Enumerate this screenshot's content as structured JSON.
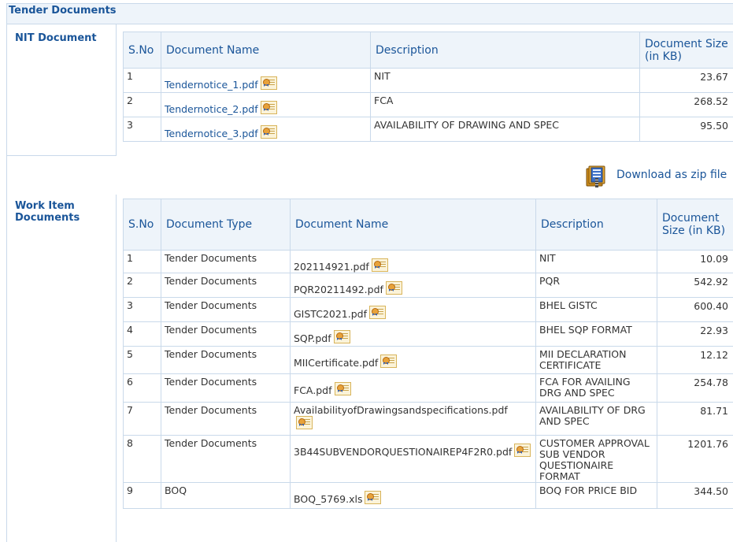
{
  "section": {
    "title": "Tender Documents"
  },
  "nit": {
    "label": "NIT Document",
    "headers": {
      "sno": "S.No",
      "name": "Document Name",
      "description": "Description",
      "size": "Document Size (in KB)"
    },
    "rows": [
      {
        "sno": "1",
        "name": "Tendernotice_1.pdf",
        "description": "NIT",
        "size": "23.67"
      },
      {
        "sno": "2",
        "name": "Tendernotice_2.pdf",
        "description": "FCA",
        "size": "268.52"
      },
      {
        "sno": "3",
        "name": "Tendernotice_3.pdf",
        "description": "AVAILABILITY OF DRAWING AND SPEC",
        "size": "95.50"
      }
    ]
  },
  "zip": {
    "label": "Download as zip file",
    "icon": "zip-archive-icon"
  },
  "work": {
    "label": "Work Item Documents",
    "headers": {
      "sno": "S.No",
      "type": "Document Type",
      "name": "Document Name",
      "description": "Description",
      "size": "Document Size (in KB)"
    },
    "rows": [
      {
        "sno": "1",
        "type": "Tender Documents",
        "name": "202114921.pdf",
        "description": "NIT",
        "size": "10.09"
      },
      {
        "sno": "2",
        "type": "Tender Documents",
        "name": "PQR20211492.pdf",
        "description": "PQR",
        "size": "542.92"
      },
      {
        "sno": "3",
        "type": "Tender Documents",
        "name": "GISTC2021.pdf",
        "description": "BHEL GISTC",
        "size": "600.40"
      },
      {
        "sno": "4",
        "type": "Tender Documents",
        "name": "SQP.pdf",
        "description": "BHEL SQP FORMAT",
        "size": "22.93"
      },
      {
        "sno": "5",
        "type": "Tender Documents",
        "name": "MIICertificate.pdf",
        "description": "MII DECLARATION CERTIFICATE",
        "size": "12.12"
      },
      {
        "sno": "6",
        "type": "Tender Documents",
        "name": "FCA.pdf",
        "description": "FCA FOR AVAILING DRG AND SPEC",
        "size": "254.78"
      },
      {
        "sno": "7",
        "type": "Tender Documents",
        "name": "AvailabilityofDrawingsandspecifications.pdf",
        "description": "AVAILABILITY OF DRG AND SPEC",
        "size": "81.71"
      },
      {
        "sno": "8",
        "type": "Tender Documents",
        "name": "3B44SUBVENDORQUESTIONAIREP4F2R0.pdf",
        "description": "CUSTOMER APPROVAL SUB VENDOR QUESTIONAIRE FORMAT",
        "size": "1201.76"
      },
      {
        "sno": "9",
        "type": "BOQ",
        "name": "BOQ_5769.xls",
        "description": "BOQ FOR PRICE BID",
        "size": "344.50"
      }
    ]
  },
  "colors": {
    "heading": "#1a5599",
    "border": "#c9d9ea",
    "header_bg": "#eef4fa"
  }
}
